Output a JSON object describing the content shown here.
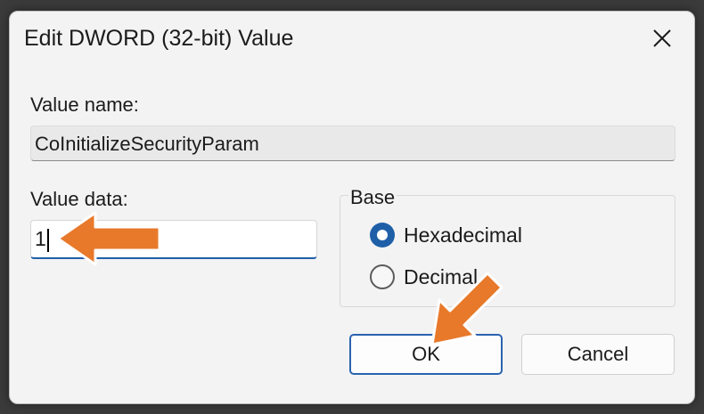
{
  "dialog": {
    "title": "Edit DWORD (32-bit) Value",
    "close_icon": "close-icon"
  },
  "value_name": {
    "label": "Value name:",
    "value": "CoInitializeSecurityParam"
  },
  "value_data": {
    "label": "Value data:",
    "value": "1"
  },
  "base": {
    "legend": "Base",
    "options": [
      {
        "label": "Hexadecimal",
        "selected": true
      },
      {
        "label": "Decimal",
        "selected": false
      }
    ]
  },
  "buttons": {
    "ok_label": "OK",
    "cancel_label": "Cancel"
  },
  "colors": {
    "accent": "#1f5fa8",
    "annotation_arrow": "#e8792b"
  }
}
